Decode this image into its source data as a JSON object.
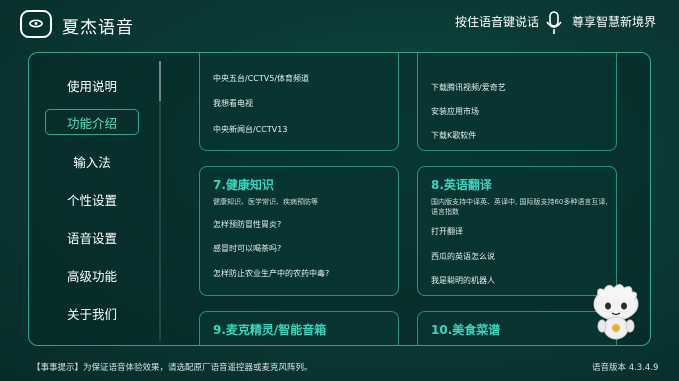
{
  "header": {
    "app_title": "夏杰语音",
    "hint": "按住语音键说话",
    "slogan": "尊享智慧新境界"
  },
  "sidebar": {
    "items": [
      {
        "label": "使用说明"
      },
      {
        "label": "功能介绍",
        "active": true
      },
      {
        "label": "输入法"
      },
      {
        "label": "个性设置"
      },
      {
        "label": "语音设置"
      },
      {
        "label": "高级功能"
      },
      {
        "label": "关于我们"
      }
    ]
  },
  "cards": [
    {
      "desc": "",
      "items": [
        "中央五台/CCTV5/体育频道",
        "我想看电视",
        "中央新闻台/CCTV13"
      ]
    },
    {
      "desc": "",
      "items": [
        "下载腾讯视频/爱奇艺",
        "安装应用市场",
        "下载K歌软件"
      ]
    },
    {
      "title": "7.健康知识",
      "desc": "健康知识、医学常识、疾病预防等",
      "items": [
        "怎样预防冒性胃炎?",
        "感冒时可以喝茶吗?",
        "怎样防止农业生产中的农药中毒?"
      ]
    },
    {
      "title": "8.英语翻译",
      "desc": "国内版支持中译英、英译中, 国际版支持60多种语言互译, 语言指数",
      "items": [
        "打开翻译",
        "西瓜的英语怎么说",
        "我是聪明的机器人"
      ]
    },
    {
      "title": "9.麦克精灵/智能音箱"
    },
    {
      "title": "10.美食菜谱"
    }
  ],
  "footer": {
    "tip": "【事事提示】为保证语音体验效果，请选配原厂语音遥控器或麦克风阵列。",
    "version": "语音版本 4.3.4.9"
  },
  "icons": {
    "logo": "logo-icon",
    "mic": "microphone-icon",
    "mascot": "mascot-robot"
  },
  "colors": {
    "accent": "#38d6bd",
    "border": "#2fa494",
    "background": "#0a3a36"
  }
}
